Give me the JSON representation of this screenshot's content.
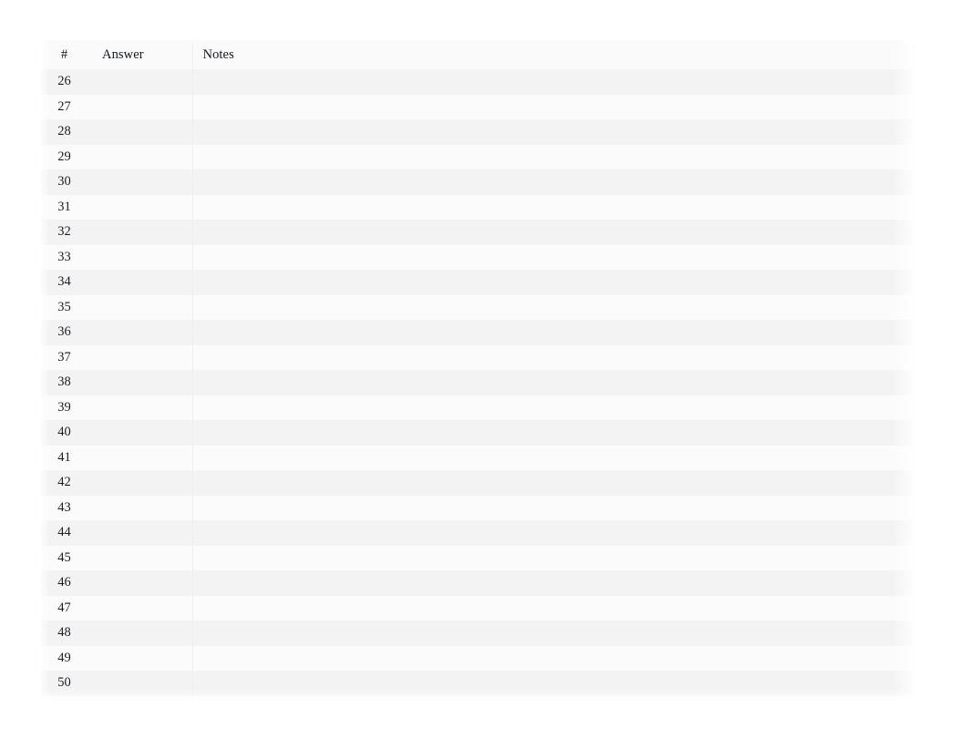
{
  "table": {
    "name": "answer-sheet",
    "columns": [
      {
        "key": "num",
        "label": "#"
      },
      {
        "key": "answer",
        "label": "Answer"
      },
      {
        "key": "notes",
        "label": "Notes"
      }
    ],
    "rows": [
      {
        "num": "26",
        "answer": "",
        "notes": ""
      },
      {
        "num": "27",
        "answer": "",
        "notes": ""
      },
      {
        "num": "28",
        "answer": "",
        "notes": ""
      },
      {
        "num": "29",
        "answer": "",
        "notes": ""
      },
      {
        "num": "30",
        "answer": "",
        "notes": ""
      },
      {
        "num": "31",
        "answer": "",
        "notes": ""
      },
      {
        "num": "32",
        "answer": "",
        "notes": ""
      },
      {
        "num": "33",
        "answer": "",
        "notes": ""
      },
      {
        "num": "34",
        "answer": "",
        "notes": ""
      },
      {
        "num": "35",
        "answer": "",
        "notes": ""
      },
      {
        "num": "36",
        "answer": "",
        "notes": ""
      },
      {
        "num": "37",
        "answer": "",
        "notes": ""
      },
      {
        "num": "38",
        "answer": "",
        "notes": ""
      },
      {
        "num": "39",
        "answer": "",
        "notes": ""
      },
      {
        "num": "40",
        "answer": "",
        "notes": ""
      },
      {
        "num": "41",
        "answer": "",
        "notes": ""
      },
      {
        "num": "42",
        "answer": "",
        "notes": ""
      },
      {
        "num": "43",
        "answer": "",
        "notes": ""
      },
      {
        "num": "44",
        "answer": "",
        "notes": ""
      },
      {
        "num": "45",
        "answer": "",
        "notes": ""
      },
      {
        "num": "46",
        "answer": "",
        "notes": ""
      },
      {
        "num": "47",
        "answer": "",
        "notes": ""
      },
      {
        "num": "48",
        "answer": "",
        "notes": ""
      },
      {
        "num": "49",
        "answer": "",
        "notes": ""
      },
      {
        "num": "50",
        "answer": "",
        "notes": ""
      }
    ]
  },
  "colors": {
    "page_background": "#ffffff",
    "header_background": "#fafafa",
    "row_stripe_dark": "#f3f3f4",
    "row_stripe_light": "#fbfbfc",
    "text": "#1a1c20",
    "column_divider": "#ededee"
  }
}
